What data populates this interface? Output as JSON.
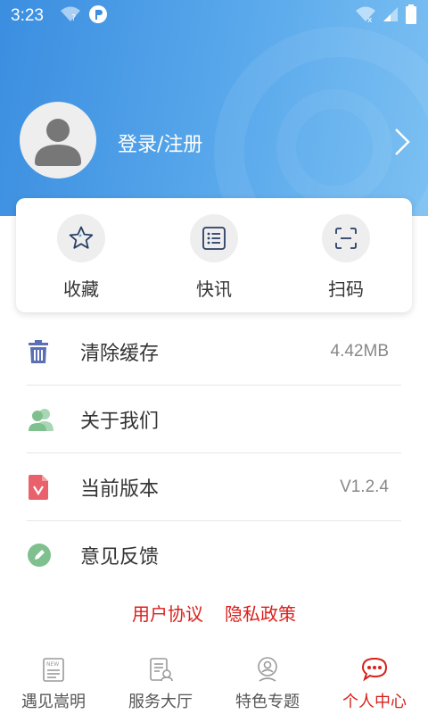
{
  "status_bar": {
    "time": "3:23"
  },
  "profile": {
    "login_label": "登录/注册"
  },
  "quick_actions": [
    {
      "label": "收藏",
      "icon": "star-icon"
    },
    {
      "label": "快讯",
      "icon": "list-icon"
    },
    {
      "label": "扫码",
      "icon": "scan-icon"
    }
  ],
  "menu": {
    "clear_cache": {
      "label": "清除缓存",
      "value": "4.42MB"
    },
    "about_us": {
      "label": "关于我们"
    },
    "current_version": {
      "label": "当前版本",
      "value": "V1.2.4"
    },
    "feedback": {
      "label": "意见反馈"
    }
  },
  "links": {
    "user_agreement": "用户协议",
    "privacy_policy": "隐私政策"
  },
  "bottom_nav": [
    {
      "label": "遇见嵩明",
      "icon": "news-icon",
      "active": false
    },
    {
      "label": "服务大厅",
      "icon": "service-hall-icon",
      "active": false
    },
    {
      "label": "特色专题",
      "icon": "topic-icon",
      "active": false
    },
    {
      "label": "个人中心",
      "icon": "chat-bubble-icon",
      "active": true
    }
  ],
  "colors": {
    "header_start": "#3b8ee0",
    "header_end": "#7cc0f2",
    "accent_red": "#d9211c",
    "icon_blue": "#5b6fb5",
    "icon_green": "#7fc08f",
    "icon_pink": "#e8616b"
  }
}
